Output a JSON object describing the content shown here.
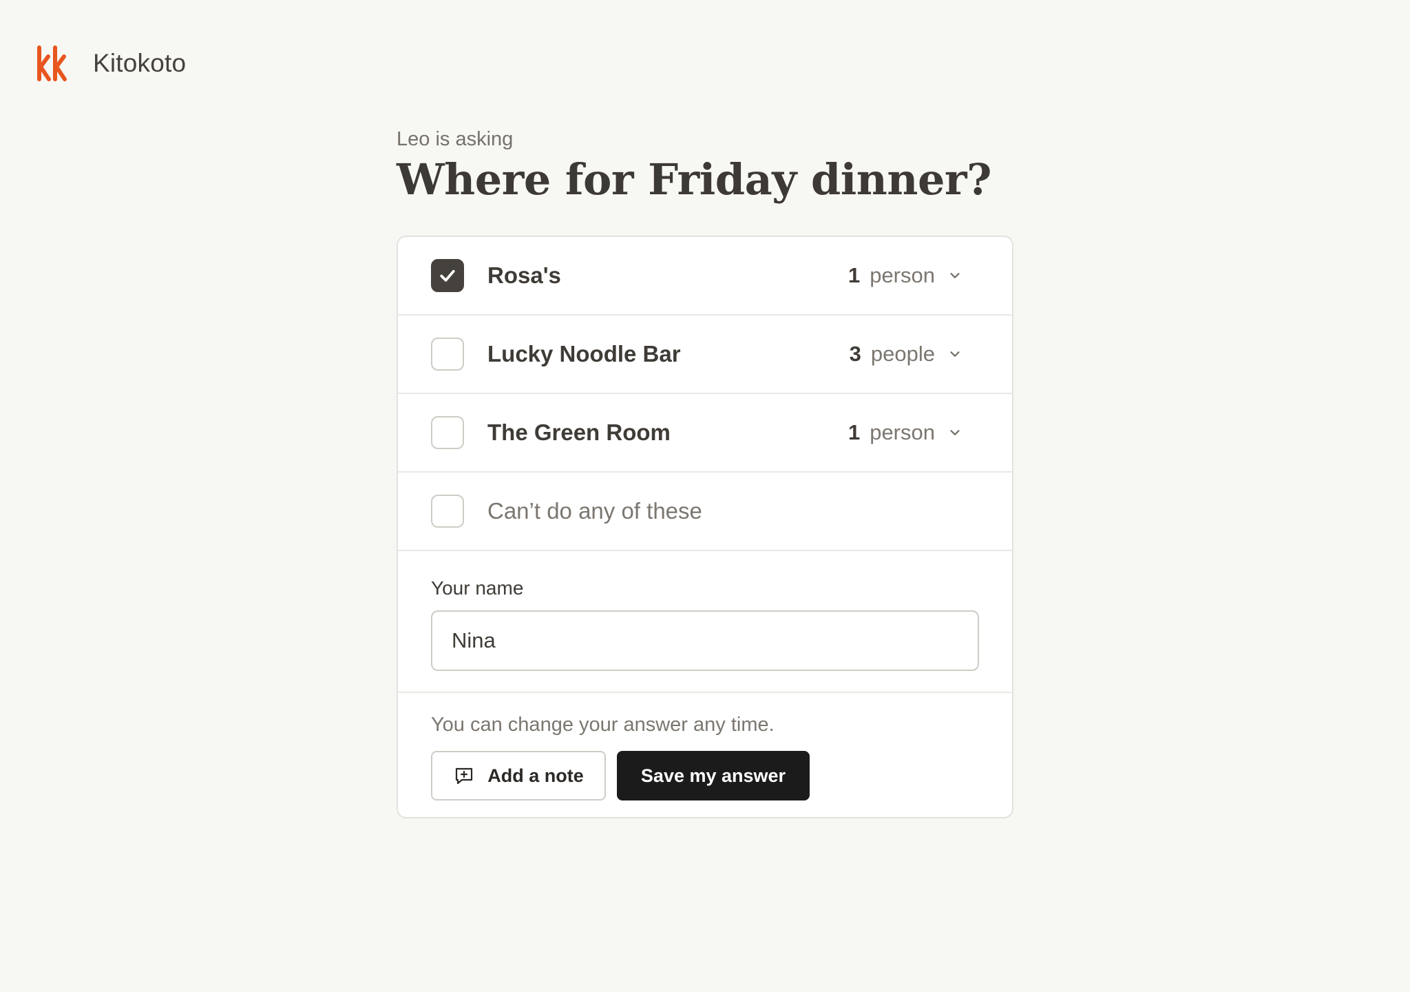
{
  "app": {
    "name": "Kitokoto",
    "brand_color": "#e8551f"
  },
  "poll": {
    "asker": "Leo is asking",
    "question": "Where for Friday dinner?",
    "options": [
      {
        "label": "Rosa's",
        "checked": true,
        "count": "1",
        "unit": "person"
      },
      {
        "label": "Lucky Noodle Bar",
        "checked": false,
        "count": "3",
        "unit": "people"
      },
      {
        "label": "The Green Room",
        "checked": false,
        "count": "1",
        "unit": "person"
      }
    ],
    "none_option": {
      "label": "Can’t do any of these",
      "checked": false
    }
  },
  "form": {
    "name_label": "Your name",
    "name_value": "Nina",
    "hint": "You can change your answer any time.",
    "add_note_label": "Add a note",
    "save_label": "Save my answer"
  },
  "icons": {
    "logo": "kitokoto-logo-icon",
    "check": "check-icon",
    "chevron": "chevron-down-icon",
    "note": "message-plus-icon"
  }
}
